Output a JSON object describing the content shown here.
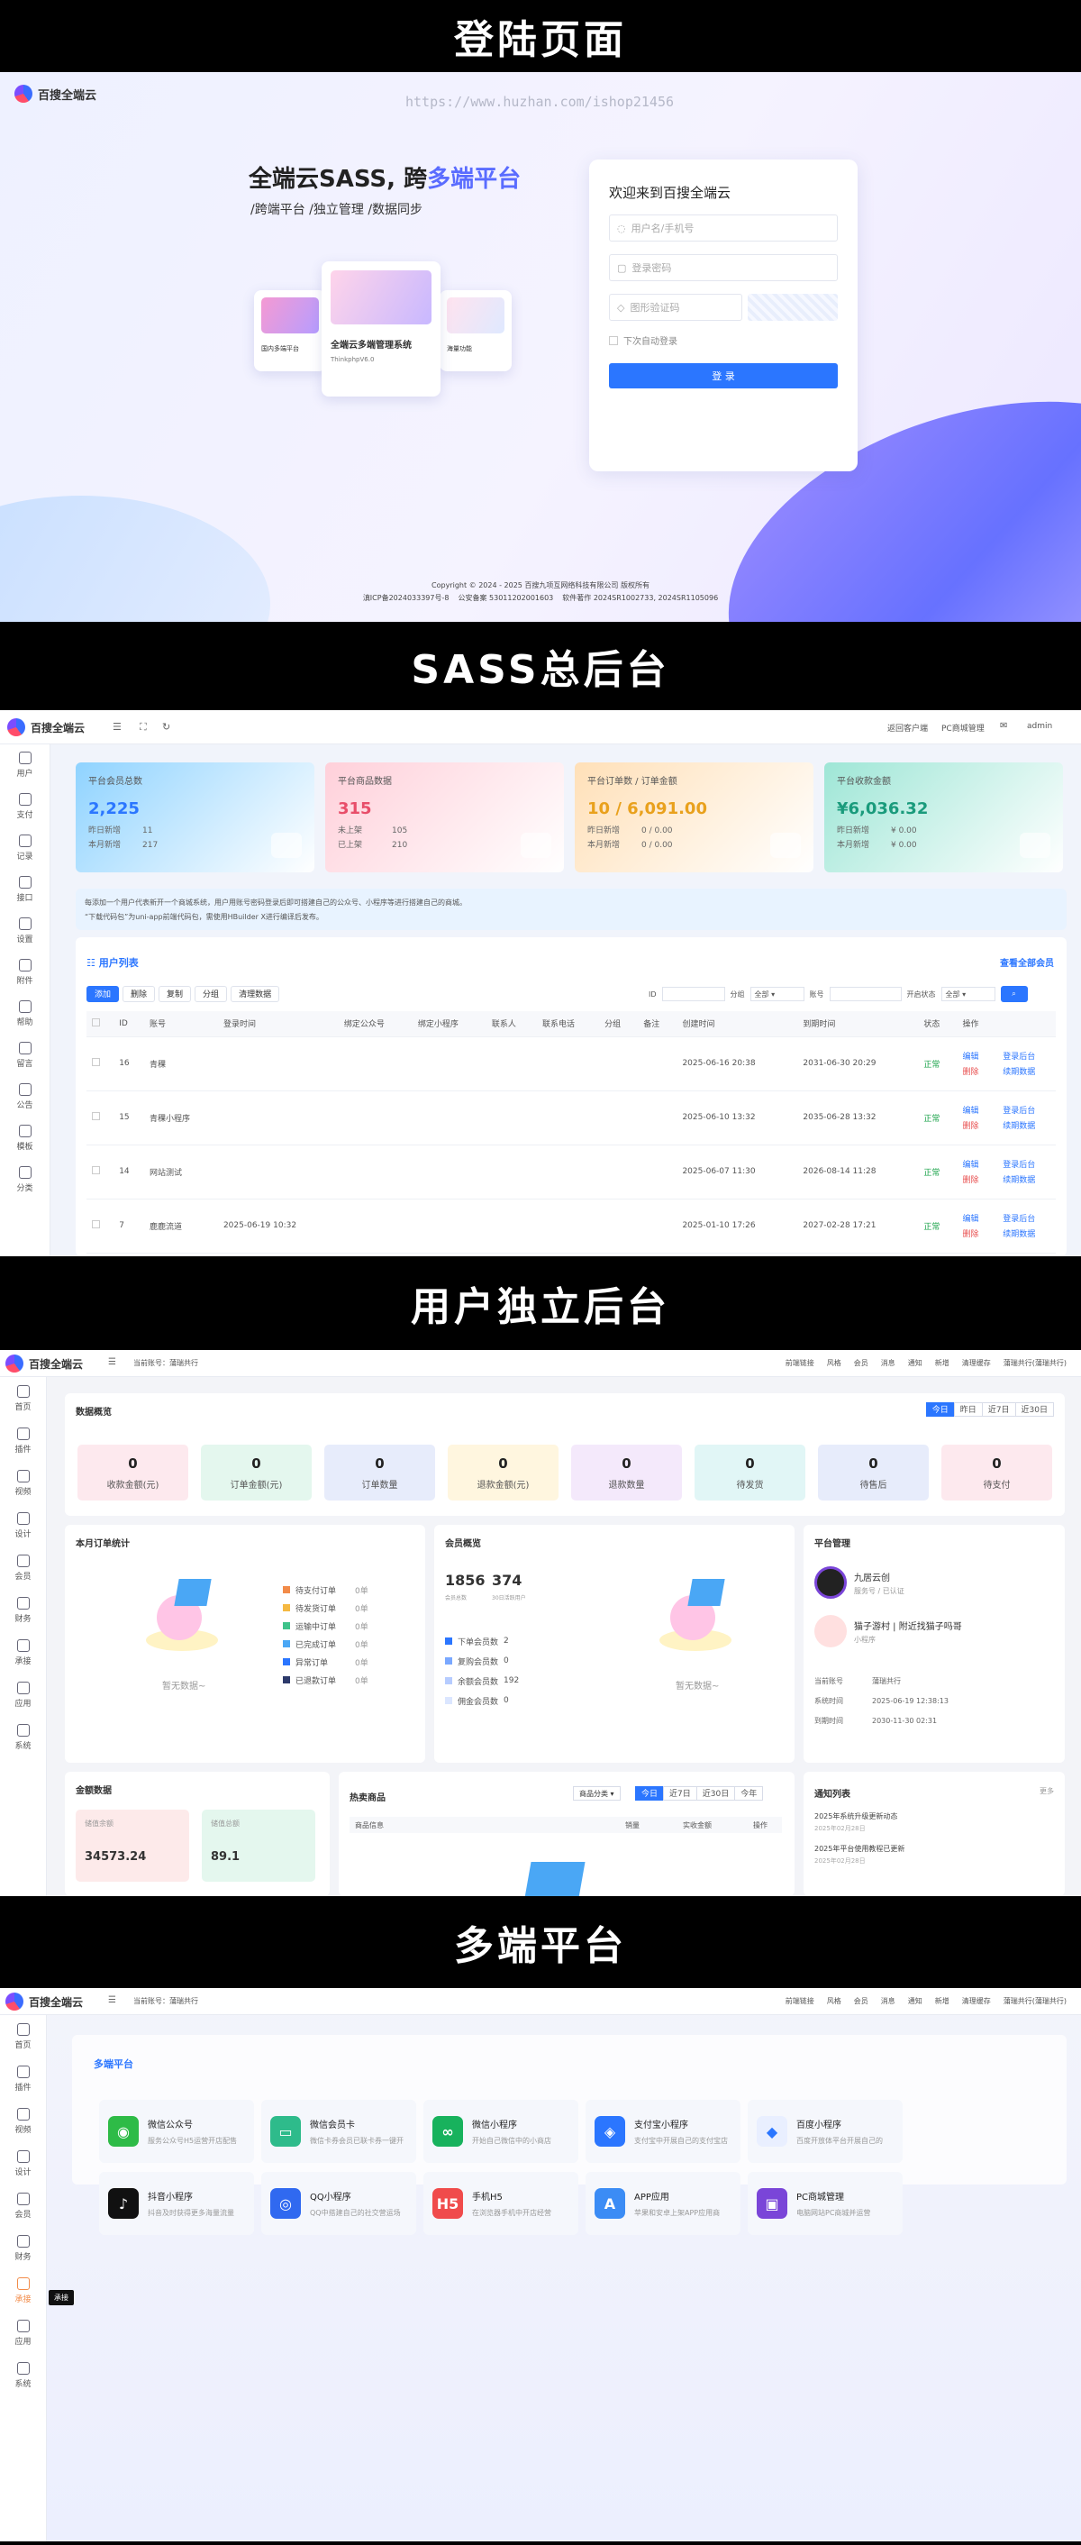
{
  "banners": {
    "login": "登陆页面",
    "sass": "SASS总后台",
    "user": "用户独立后台",
    "platform": "多端平台"
  },
  "brand": "百搜全端云",
  "login": {
    "url": "https://www.huzhan.com/ishop21456",
    "hero_title_a": "全端云SASS, 跨",
    "hero_title_b": "多端平台",
    "hero_sub": "/跨端平台 /独立管理 /数据同步",
    "center_card_title": "全端云多端管理系统",
    "center_card_tag": "ThinkphpV6.0",
    "left_card_title": "国内多端平台",
    "right_card_title": "海量功能",
    "welcome": "欢迎来到百搜全端云",
    "user_ph": "用户名/手机号",
    "pwd_ph": "登录密码",
    "captcha_ph": "图形验证码",
    "remember": "下次自动登录",
    "btn": "登 录",
    "copyright": "Copyright © 2024 - 2025 百搜九项互网络科技有限公司 版权所有",
    "icp": "滇ICP备2024033397号-8",
    "police": "公安备案 53011202001603",
    "soft": "软件著作 2024SR1002733, 2024SR1105096"
  },
  "sass": {
    "top_links": [
      "返回客户端",
      "PC商城管理",
      "admin"
    ],
    "side": [
      "用户",
      "支付",
      "记录",
      "接口",
      "设置",
      "附件",
      "帮助",
      "留言",
      "公告",
      "模板",
      "分类"
    ],
    "cards": [
      {
        "title": "平台会员总数",
        "value": "2,225",
        "l1": "昨日新增",
        "v1": "11",
        "l2": "本月新增",
        "v2": "217",
        "color": "#8fd3ff"
      },
      {
        "title": "平台商品数据",
        "value": "315",
        "l1": "未上架",
        "v1": "105",
        "l2": "已上架",
        "v2": "210",
        "color": "#ffd0da"
      },
      {
        "title": "平台订单数 / 订单金额",
        "value": "10 / 6,091.00",
        "l1": "昨日新增",
        "v1": "0 / 0.00",
        "l2": "本月新增",
        "v2": "0 / 0.00",
        "color": "#ffe0b8"
      },
      {
        "title": "平台收款金额",
        "value": "¥6,036.32",
        "l1": "昨日新增",
        "v1": "¥ 0.00",
        "l2": "本月新增",
        "v2": "¥ 0.00",
        "color": "#9ee6d6"
      }
    ],
    "notice1": "每添加一个用户代表新开一个商城系统，用户用账号密码登录后即可搭建自己的公众号、小程序等进行搭建自己的商城。",
    "notice2": "“下载代码包”为uni-app前端代码包，需使用HBuilder X进行编译后发布。",
    "list_title": "用户列表",
    "view_all": "查看全部会员",
    "btns": [
      "添加",
      "删除",
      "复制",
      "分组",
      "清理数据"
    ],
    "filters": [
      "ID",
      "分组",
      "全部",
      "账号",
      "开启状态",
      "全部"
    ],
    "cols": [
      "ID",
      "账号",
      "登录时间",
      "绑定公众号",
      "绑定小程序",
      "联系人",
      "联系电话",
      "分组",
      "备注",
      "创建时间",
      "到期时间",
      "状态",
      "操作"
    ],
    "rows": [
      {
        "id": "16",
        "acc": "青稞",
        "login": "",
        "c": "2025-06-16 20:38",
        "e": "2031-06-30 20:29",
        "s": "正常"
      },
      {
        "id": "15",
        "acc": "青稞小程序",
        "login": "",
        "c": "2025-06-10 13:32",
        "e": "2035-06-28 13:32",
        "s": "正常"
      },
      {
        "id": "14",
        "acc": "网站测试",
        "login": "",
        "c": "2025-06-07 11:30",
        "e": "2026-08-14 11:28",
        "s": "正常"
      },
      {
        "id": "7",
        "acc": "鹿鹿流道",
        "login": "2025-06-19 10:32",
        "c": "2025-01-10 17:26",
        "e": "2027-02-28 17:21",
        "s": "正常"
      }
    ],
    "ops": [
      "编辑",
      "登录后台",
      "删除",
      "续期数据"
    ]
  },
  "user": {
    "account": "当前账号：蒲瑞共行",
    "top": [
      "前端链接",
      "风格",
      "会员",
      "消息",
      "通知",
      "新增",
      "清理缓存",
      "蒲瑞共行(蒲瑞共行)"
    ],
    "side": [
      "首页",
      "插件",
      "视频",
      "设计",
      "会员",
      "财务",
      "承接",
      "应用",
      "系统"
    ],
    "overview": "数据概览",
    "ranges": [
      "今日",
      "昨日",
      "近7日",
      "近30日"
    ],
    "stats": [
      {
        "n": "0",
        "l": "收款金额(元)",
        "bg": "#fde9ee"
      },
      {
        "n": "0",
        "l": "订单金额(元)",
        "bg": "#e4f7ee"
      },
      {
        "n": "0",
        "l": "订单数量",
        "bg": "#e7ecfb"
      },
      {
        "n": "0",
        "l": "退款金额(元)",
        "bg": "#fff6df"
      },
      {
        "n": "0",
        "l": "退款数量",
        "bg": "#f4e9fb"
      },
      {
        "n": "0",
        "l": "待发货",
        "bg": "#e1f6f6"
      },
      {
        "n": "0",
        "l": "待售后",
        "bg": "#e7ecfb"
      },
      {
        "n": "0",
        "l": "待支付",
        "bg": "#fde9ee"
      }
    ],
    "order_title": "本月订单统计",
    "order_legend": [
      {
        "l": "待支付订单",
        "v": "0单",
        "c": "#f28b49"
      },
      {
        "l": "待发货订单",
        "v": "0单",
        "c": "#f5b942"
      },
      {
        "l": "运输中订单",
        "v": "0单",
        "c": "#3ec38a"
      },
      {
        "l": "已完成订单",
        "v": "0单",
        "c": "#4aa7f5"
      },
      {
        "l": "异常订单",
        "v": "0单",
        "c": "#2b76ff"
      },
      {
        "l": "已退款订单",
        "v": "0单",
        "c": "#2d3a6b"
      }
    ],
    "empty": "暂无数据~",
    "member_title": "会员概览",
    "m_total": "1856",
    "m_total_l": "会员总数",
    "m_active": "374",
    "m_active_l": "30日活跃用户",
    "member_legend": [
      {
        "l": "下单会员数",
        "v": "2",
        "c": "#2b76ff"
      },
      {
        "l": "复购会员数",
        "v": "0",
        "c": "#7aa8ff"
      },
      {
        "l": "余额会员数",
        "v": "192",
        "c": "#b6ccff"
      },
      {
        "l": "佣金会员数",
        "v": "0",
        "c": "#dbe6ff"
      }
    ],
    "plat_title": "平台管理",
    "plat_name": "九居云创",
    "plat_sub": "服务号 / 已认证",
    "plat2_name": "猫子游村 | 附近找猫子吗哥",
    "plat2_sub": "小程序",
    "info": [
      [
        "当前账号",
        "蒲瑞共行"
      ],
      [
        "系统时间",
        "2025-06-19 12:38:13"
      ],
      [
        "到期时间",
        "2030-11-30 02:31"
      ]
    ],
    "balance_title": "金额数据",
    "bal1_l": "储值余额",
    "bal1_v": "34573.24",
    "bal2_l": "储值总额",
    "bal2_v": "89.1",
    "hot_title": "热卖商品",
    "hot_sel": "商品分类",
    "hot_ranges": [
      "今日",
      "近7日",
      "近30日",
      "今年"
    ],
    "hot_cols": [
      "商品信息",
      "销量",
      "实收金额",
      "操作"
    ],
    "news_title": "通知列表",
    "news_more": "更多",
    "news": [
      {
        "t": "2025年系统升级更新动态",
        "d": "2025年02月28日"
      },
      {
        "t": "2025年平台使用教程已更新",
        "d": "2025年02月28日"
      }
    ]
  },
  "platform": {
    "title": "多端平台",
    "tooltip": "承接",
    "apps": [
      {
        "n": "微信公众号",
        "d": "服务公众号H5运营开店配售",
        "bg": "#2ebb47",
        "g": "◉"
      },
      {
        "n": "微信会员卡",
        "d": "微信卡券会员已联卡券一键开",
        "bg": "#2ebb8b",
        "g": "▭"
      },
      {
        "n": "微信小程序",
        "d": "开始自己微信中的小商店",
        "bg": "#18b25d",
        "g": "∞"
      },
      {
        "n": "支付宝小程序",
        "d": "支付宝中开展自己的支付宝店",
        "bg": "#2b76ff",
        "g": "◈"
      },
      {
        "n": "百度小程序",
        "d": "百度开放体平台开展自己的",
        "bg": "#e9efff",
        "g": "◆"
      },
      {
        "n": "抖音小程序",
        "d": "抖音及时获得更多海量流量",
        "bg": "#111111",
        "g": "♪"
      },
      {
        "n": "QQ小程序",
        "d": "QQ中搭建自己的社交营运场",
        "bg": "#3069f0",
        "g": "◎"
      },
      {
        "n": "手机H5",
        "d": "在浏览器手机中开店经营",
        "bg": "#f04b4b",
        "g": "H5"
      },
      {
        "n": "APP应用",
        "d": "苹果和安卓上架APP应用商",
        "bg": "#3b8cf5",
        "g": "A"
      },
      {
        "n": "PC商城管理",
        "d": "电脑网站PC商城并运营",
        "bg": "#7a45d8",
        "g": "▣"
      }
    ]
  }
}
